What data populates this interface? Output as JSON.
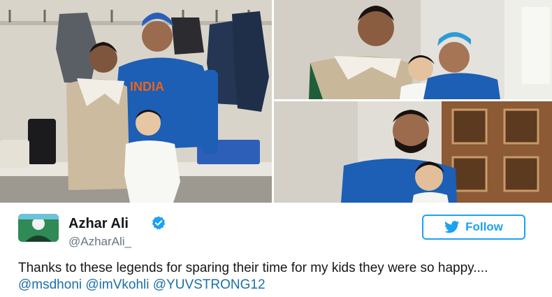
{
  "tweet": {
    "author_name": "Azhar Ali",
    "handle": "@AzharAli_",
    "follow_label": "Follow",
    "text_plain": "Thanks to these legends for sparing their time for my kids they were so happy.... ",
    "mentions": [
      "@msdhoni",
      "@imVkohli",
      "@YUVSTRONG12"
    ],
    "jersey_text": "INDIA"
  },
  "icons": {
    "verified": "verified-badge-icon",
    "twitter": "twitter-bird-icon",
    "info": "info-icon"
  },
  "colors": {
    "brand_blue": "#1da1f2",
    "mention_blue": "#1b6fa8",
    "jersey_blue": "#1c5fb5"
  }
}
